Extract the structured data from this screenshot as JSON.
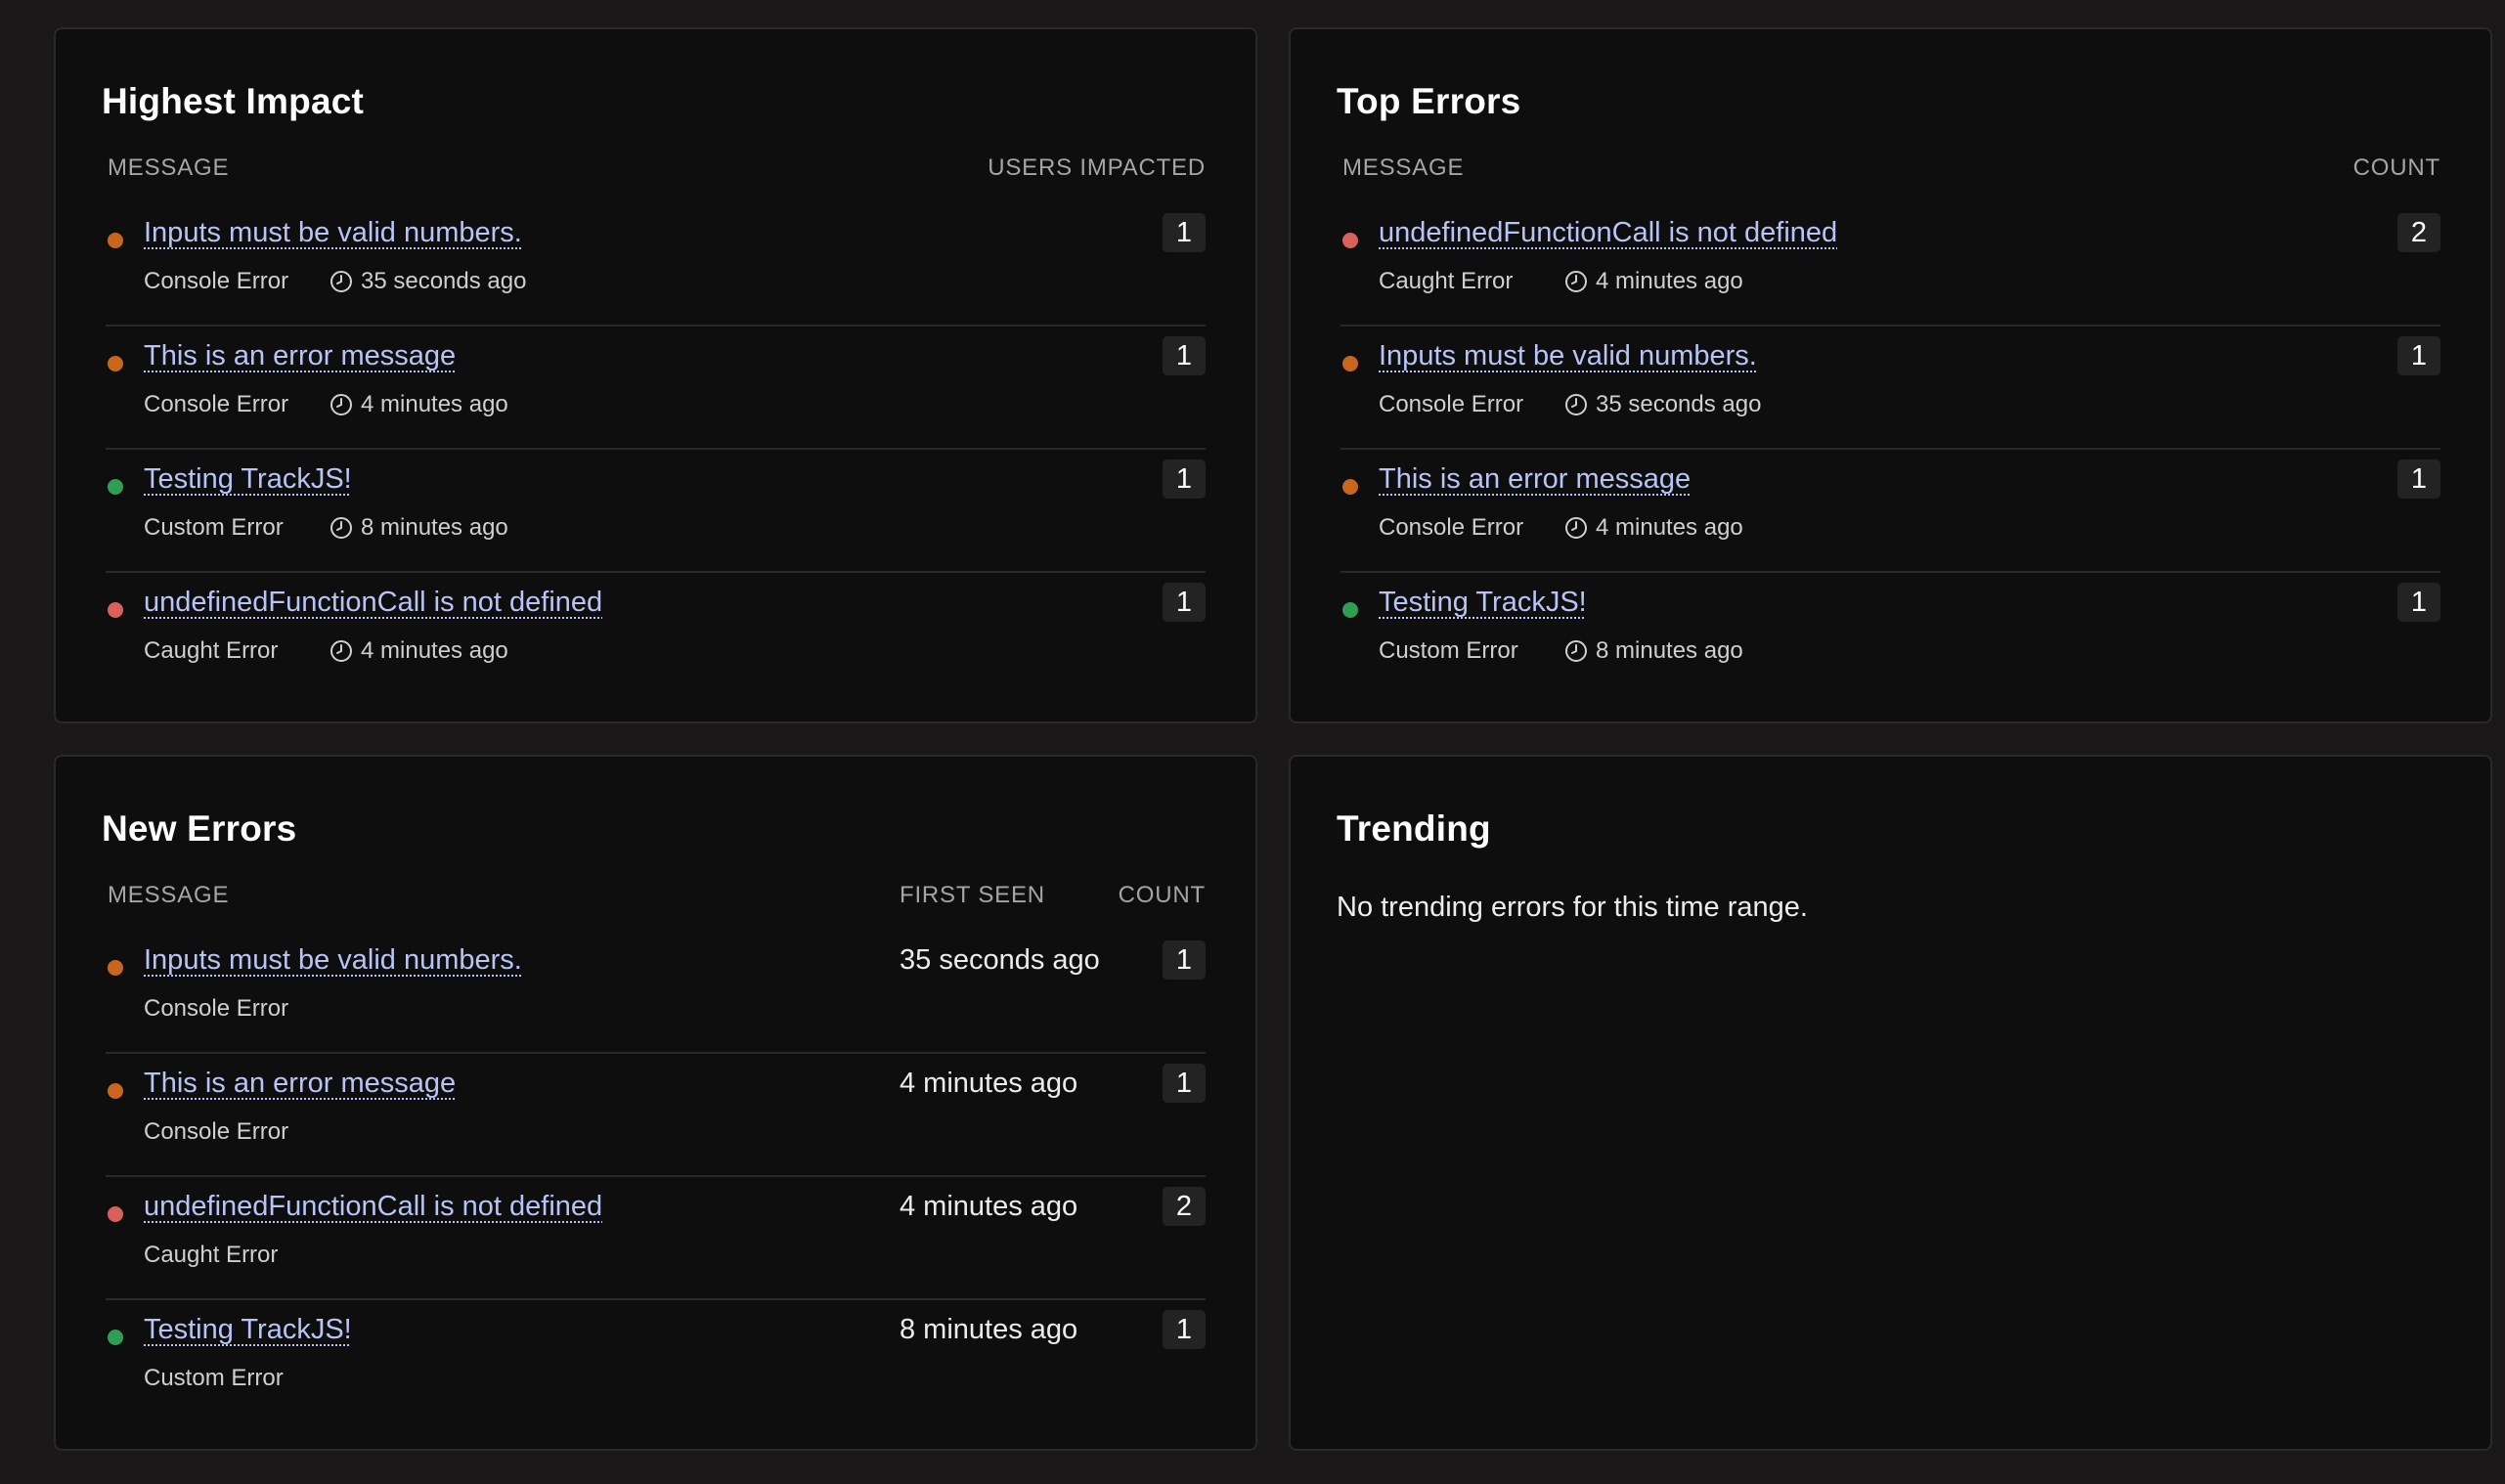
{
  "colors": {
    "orange": "#c8661c",
    "red": "#d9605b",
    "green": "#2f9e52",
    "link": "#b7c4f5"
  },
  "icons": {
    "meta": "clock-icon"
  },
  "highest_impact": {
    "title": "Highest Impact",
    "col_message": "MESSAGE",
    "col_users": "USERS IMPACTED",
    "rows": [
      {
        "message": "Inputs must be valid numbers.",
        "type": "Console Error",
        "time": "35 seconds ago",
        "count": "1",
        "severity": "orange"
      },
      {
        "message": "This is an error message",
        "type": "Console Error",
        "time": "4 minutes ago",
        "count": "1",
        "severity": "orange"
      },
      {
        "message": "Testing TrackJS!",
        "type": "Custom Error",
        "time": "8 minutes ago",
        "count": "1",
        "severity": "green"
      },
      {
        "message": "undefinedFunctionCall is not defined",
        "type": "Caught Error",
        "time": "4 minutes ago",
        "count": "1",
        "severity": "red"
      }
    ]
  },
  "top_errors": {
    "title": "Top Errors",
    "col_message": "MESSAGE",
    "col_count": "COUNT",
    "rows": [
      {
        "message": "undefinedFunctionCall is not defined",
        "type": "Caught Error",
        "time": "4 minutes ago",
        "count": "2",
        "severity": "red"
      },
      {
        "message": "Inputs must be valid numbers.",
        "type": "Console Error",
        "time": "35 seconds ago",
        "count": "1",
        "severity": "orange"
      },
      {
        "message": "This is an error message",
        "type": "Console Error",
        "time": "4 minutes ago",
        "count": "1",
        "severity": "orange"
      },
      {
        "message": "Testing TrackJS!",
        "type": "Custom Error",
        "time": "8 minutes ago",
        "count": "1",
        "severity": "green"
      }
    ]
  },
  "new_errors": {
    "title": "New Errors",
    "col_message": "MESSAGE",
    "col_first_seen": "FIRST SEEN",
    "col_count": "COUNT",
    "rows": [
      {
        "message": "Inputs must be valid numbers.",
        "type": "Console Error",
        "first_seen": "35 seconds ago",
        "count": "1",
        "severity": "orange"
      },
      {
        "message": "This is an error message",
        "type": "Console Error",
        "first_seen": "4 minutes ago",
        "count": "1",
        "severity": "orange"
      },
      {
        "message": "undefinedFunctionCall is not defined",
        "type": "Caught Error",
        "first_seen": "4 minutes ago",
        "count": "2",
        "severity": "red"
      },
      {
        "message": "Testing TrackJS!",
        "type": "Custom Error",
        "first_seen": "8 minutes ago",
        "count": "1",
        "severity": "green"
      }
    ]
  },
  "trending": {
    "title": "Trending",
    "empty_text": "No trending errors for this time range."
  }
}
